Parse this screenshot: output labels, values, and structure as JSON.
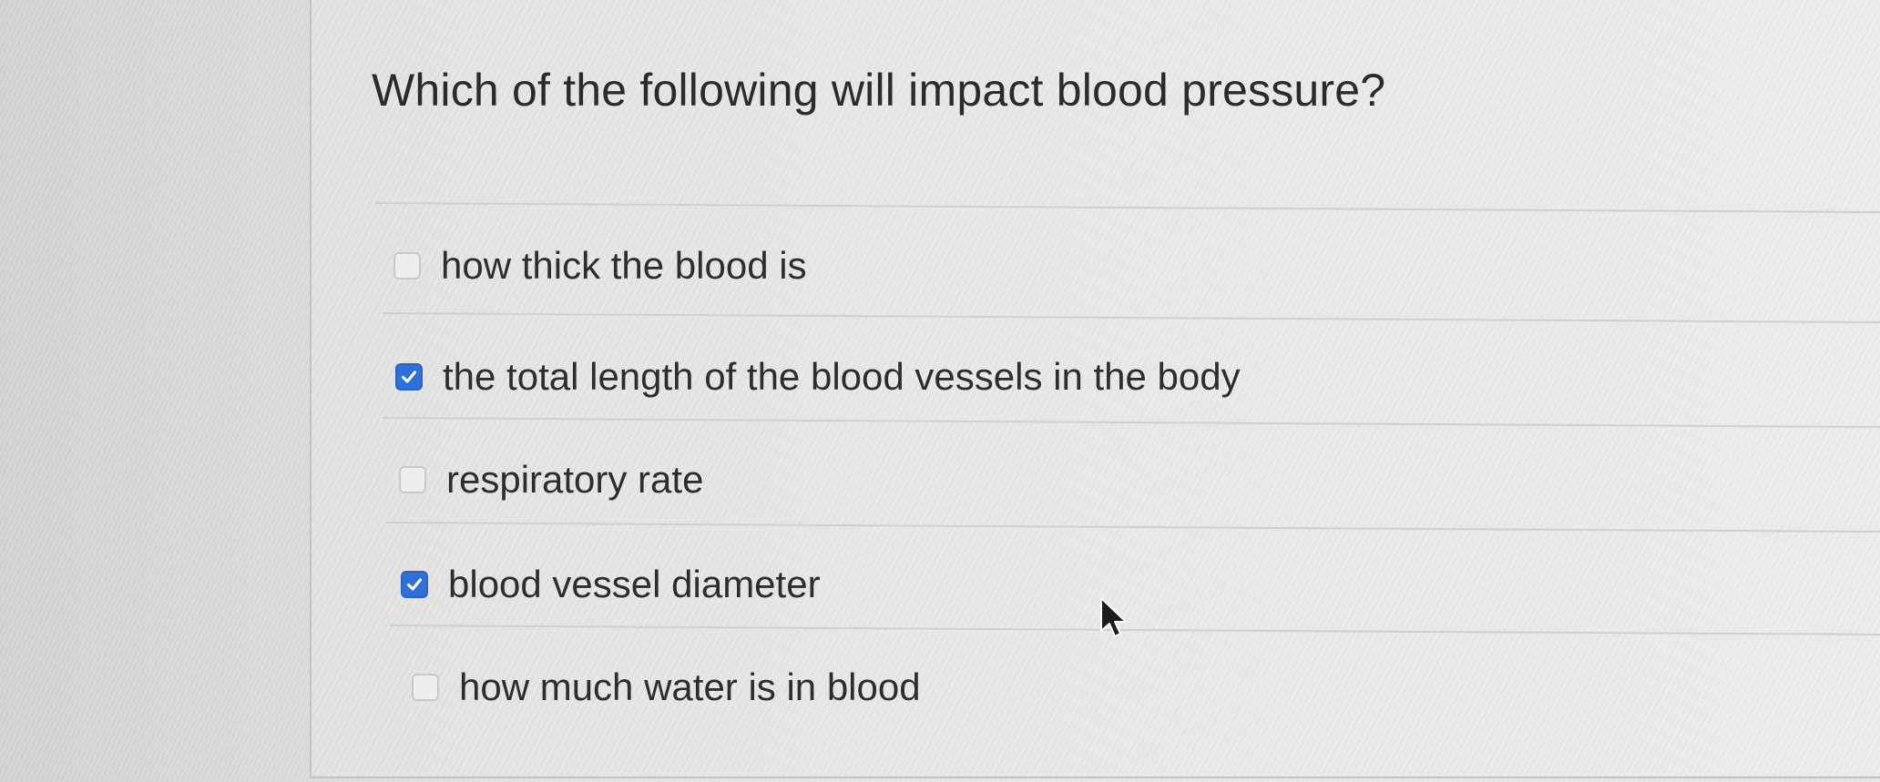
{
  "question": {
    "text": "Which of the following will impact blood pressure?"
  },
  "answers": [
    {
      "label": "how thick the blood is",
      "checked": false
    },
    {
      "label": "the total length of the blood vessels in the body",
      "checked": true
    },
    {
      "label": "respiratory rate",
      "checked": false
    },
    {
      "label": "blood vessel diameter",
      "checked": true
    },
    {
      "label": "how much water is in blood",
      "checked": false
    }
  ],
  "colors": {
    "checkbox_checked": "#2f6fd8",
    "text": "#2d2d2d"
  }
}
